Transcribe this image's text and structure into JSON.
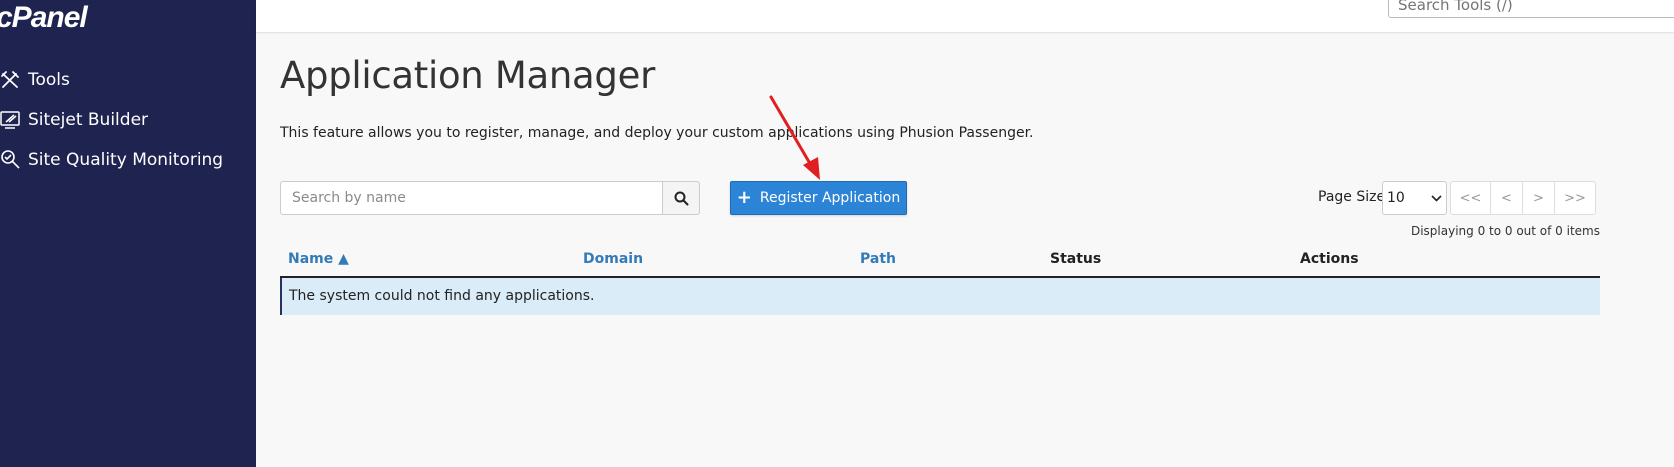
{
  "sidebar": {
    "logo": "cPanel",
    "items": [
      {
        "label": "Tools",
        "icon": "tools-icon"
      },
      {
        "label": "Sitejet Builder",
        "icon": "sitejet-icon"
      },
      {
        "label": "Site Quality Monitoring",
        "icon": "site-quality-icon"
      }
    ]
  },
  "topbar": {
    "search_placeholder": "Search Tools (/)"
  },
  "main": {
    "title": "Application Manager",
    "description": "This feature allows you to register, manage, and deploy your custom applications using Phusion Passenger.",
    "search_placeholder": "Search by name",
    "register_label": "Register Application",
    "page_size_label": "Page Size",
    "page_size_value": "10",
    "pager": {
      "first": "<<",
      "prev": "<",
      "next": ">",
      "last": ">>"
    },
    "displaying": "Displaying 0 to 0 out of 0 items",
    "table": {
      "columns": [
        "Name ▲",
        "Domain",
        "Path",
        "Status",
        "Actions"
      ],
      "empty_message": "The system could not find any applications."
    }
  },
  "colors": {
    "sidebar_bg": "#1e2350",
    "primary_button": "#2b84d6",
    "link": "#337ab7",
    "empty_row_bg": "#d9ecf8",
    "annotation_arrow": "#e02020"
  }
}
